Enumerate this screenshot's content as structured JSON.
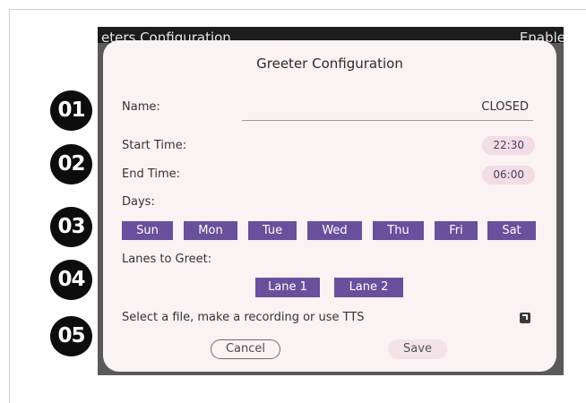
{
  "background_window": {
    "title_left": "eters Configuration",
    "title_right": "Enable"
  },
  "dialog": {
    "title": "Greeter Configuration",
    "name_label": "Name:",
    "name_value": "CLOSED",
    "start_label": "Start Time:",
    "start_value": "22:30",
    "end_label": "End Time:",
    "end_value": "06:00",
    "days_label": "Days:",
    "days": [
      "Sun",
      "Mon",
      "Tue",
      "Wed",
      "Thu",
      "Fri",
      "Sat"
    ],
    "lanes_label": "Lanes to Greet:",
    "lanes": [
      "Lane 1",
      "Lane 2"
    ],
    "file_label": "Select a file, make a recording or use TTS",
    "file_icon": "open-in-new-icon",
    "cancel_label": "Cancel",
    "save_label": "Save"
  },
  "callouts": [
    "01",
    "02",
    "03",
    "04",
    "05"
  ],
  "colors": {
    "accent": "#6a4f9c",
    "dialog_bg": "#fbf2f4",
    "pill_bg": "#f1dde3",
    "badge_bg": "#0d0d0d"
  }
}
